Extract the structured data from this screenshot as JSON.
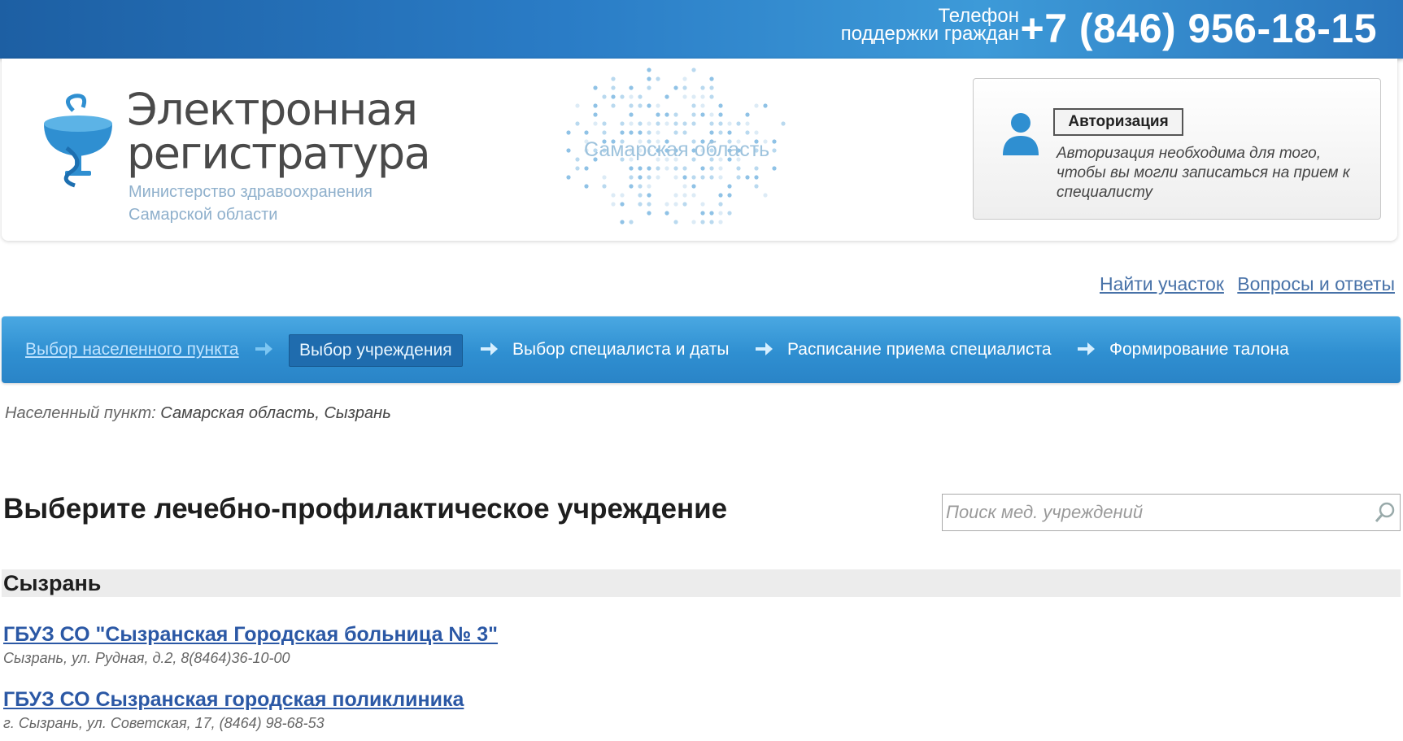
{
  "support": {
    "caption_line1": "Телефон",
    "caption_line2": "поддержки граждан",
    "phone": "+7 (846) 956-18-15"
  },
  "logo": {
    "title_line1": "Электронная",
    "title_line2": "регистратура",
    "sub_line1": "Министерство здравоохранения",
    "sub_line2": "Самарской области",
    "region": "Самарская область",
    "icon": "caduceus-bowl-icon"
  },
  "auth": {
    "button_label": "Авторизация",
    "description": "Авторизация необходима для того, чтобы вы могли записаться на прием к специалисту",
    "icon": "user-icon"
  },
  "links": {
    "find_district": "Найти участок",
    "faq": "Вопросы и ответы"
  },
  "steps": [
    {
      "label": "Выбор населенного пункта",
      "state": "done"
    },
    {
      "label": "Выбор учреждения",
      "state": "active"
    },
    {
      "label": "Выбор специалиста и даты",
      "state": "pending"
    },
    {
      "label": "Расписание приема специалиста",
      "state": "pending"
    },
    {
      "label": "Формирование талона",
      "state": "pending"
    }
  ],
  "location": {
    "label": "Населенный пункт:",
    "value": "Самарская область, Сызрань"
  },
  "main": {
    "title": "Выберите лечебно-профилактическое учреждение",
    "search_placeholder": "Поиск мед. учреждений",
    "city": "Сызрань"
  },
  "institutions": [
    {
      "name": "ГБУЗ СО \"Сызранская Городская больница № 3\"",
      "address": "Сызрань, ул. Рудная, д.2, 8(8464)36-10-00"
    },
    {
      "name": "ГБУЗ СО Сызранская городская поликлиника",
      "address": "г. Сызрань, ул. Советская, 17, (8464) 98-68-53"
    }
  ],
  "colors": {
    "brand_blue": "#2f8fd1",
    "link": "#2b58a5"
  }
}
